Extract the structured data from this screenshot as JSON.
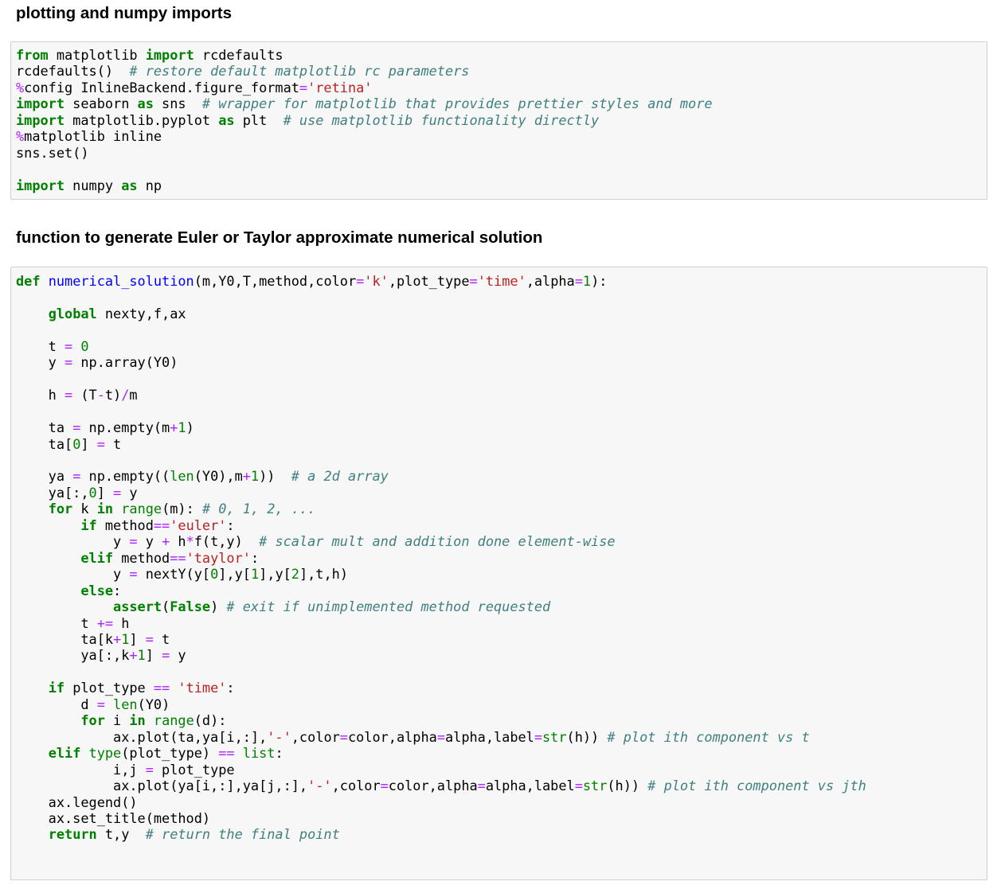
{
  "headings": {
    "imports": "plotting and numpy imports",
    "function": "function to generate Euler or Taylor approximate numerical solution"
  },
  "cells": [
    {
      "name": "imports-cell",
      "lines": [
        [
          [
            "k",
            "from"
          ],
          [
            "t",
            " matplotlib "
          ],
          [
            "k",
            "import"
          ],
          [
            "t",
            " rcdefaults"
          ]
        ],
        [
          [
            "t",
            "rcdefaults()  "
          ],
          [
            "c",
            "# restore default matplotlib rc parameters"
          ]
        ],
        [
          [
            "m",
            "%"
          ],
          [
            "t",
            "config InlineBackend.figure_format"
          ],
          [
            "o",
            "="
          ],
          [
            "s",
            "'retina'"
          ]
        ],
        [
          [
            "k",
            "import"
          ],
          [
            "t",
            " seaborn "
          ],
          [
            "k",
            "as"
          ],
          [
            "t",
            " sns  "
          ],
          [
            "c",
            "# wrapper for matplotlib that provides prettier styles and more"
          ]
        ],
        [
          [
            "k",
            "import"
          ],
          [
            "t",
            " matplotlib.pyplot "
          ],
          [
            "k",
            "as"
          ],
          [
            "t",
            " plt  "
          ],
          [
            "c",
            "# use matplotlib functionality directly"
          ]
        ],
        [
          [
            "m",
            "%"
          ],
          [
            "t",
            "matplotlib inline"
          ]
        ],
        [
          [
            "t",
            "sns.set()"
          ]
        ],
        [],
        [
          [
            "k",
            "import"
          ],
          [
            "t",
            " numpy "
          ],
          [
            "k",
            "as"
          ],
          [
            "t",
            " np"
          ]
        ]
      ]
    },
    {
      "name": "function-cell",
      "lines": [
        [
          [
            "k",
            "def"
          ],
          [
            "t",
            " "
          ],
          [
            "fn",
            "numerical_solution"
          ],
          [
            "t",
            "(m,Y0,T,method,color"
          ],
          [
            "o",
            "="
          ],
          [
            "s",
            "'k'"
          ],
          [
            "t",
            ",plot_type"
          ],
          [
            "o",
            "="
          ],
          [
            "s",
            "'time'"
          ],
          [
            "t",
            ",alpha"
          ],
          [
            "o",
            "="
          ],
          [
            "n",
            "1"
          ],
          [
            "t",
            "):"
          ]
        ],
        [],
        [
          [
            "t",
            "    "
          ],
          [
            "k",
            "global"
          ],
          [
            "t",
            " nexty,f,ax"
          ]
        ],
        [],
        [
          [
            "t",
            "    t "
          ],
          [
            "o",
            "="
          ],
          [
            "t",
            " "
          ],
          [
            "n",
            "0"
          ]
        ],
        [
          [
            "t",
            "    y "
          ],
          [
            "o",
            "="
          ],
          [
            "t",
            " np.array(Y0)"
          ]
        ],
        [],
        [
          [
            "t",
            "    h "
          ],
          [
            "o",
            "="
          ],
          [
            "t",
            " (T"
          ],
          [
            "o",
            "-"
          ],
          [
            "t",
            "t)"
          ],
          [
            "o",
            "/"
          ],
          [
            "t",
            "m"
          ]
        ],
        [],
        [
          [
            "t",
            "    ta "
          ],
          [
            "o",
            "="
          ],
          [
            "t",
            " np.empty(m"
          ],
          [
            "o",
            "+"
          ],
          [
            "n",
            "1"
          ],
          [
            "t",
            ")"
          ]
        ],
        [
          [
            "t",
            "    ta["
          ],
          [
            "n",
            "0"
          ],
          [
            "t",
            "] "
          ],
          [
            "o",
            "="
          ],
          [
            "t",
            " t"
          ]
        ],
        [],
        [
          [
            "t",
            "    ya "
          ],
          [
            "o",
            "="
          ],
          [
            "t",
            " np.empty(("
          ],
          [
            "bi",
            "len"
          ],
          [
            "t",
            "(Y0),m"
          ],
          [
            "o",
            "+"
          ],
          [
            "n",
            "1"
          ],
          [
            "t",
            "))  "
          ],
          [
            "c",
            "# a 2d array"
          ]
        ],
        [
          [
            "t",
            "    ya[:,"
          ],
          [
            "n",
            "0"
          ],
          [
            "t",
            "] "
          ],
          [
            "o",
            "="
          ],
          [
            "t",
            " y"
          ]
        ],
        [
          [
            "t",
            "    "
          ],
          [
            "k",
            "for"
          ],
          [
            "t",
            " k "
          ],
          [
            "k",
            "in"
          ],
          [
            "t",
            " "
          ],
          [
            "bi",
            "range"
          ],
          [
            "t",
            "(m): "
          ],
          [
            "c",
            "# 0, 1, 2, ..."
          ]
        ],
        [
          [
            "t",
            "        "
          ],
          [
            "k",
            "if"
          ],
          [
            "t",
            " method"
          ],
          [
            "o",
            "=="
          ],
          [
            "s",
            "'euler'"
          ],
          [
            "t",
            ":"
          ]
        ],
        [
          [
            "t",
            "            y "
          ],
          [
            "o",
            "="
          ],
          [
            "t",
            " y "
          ],
          [
            "o",
            "+"
          ],
          [
            "t",
            " h"
          ],
          [
            "o",
            "*"
          ],
          [
            "t",
            "f(t,y)  "
          ],
          [
            "c",
            "# scalar mult and addition done element-wise"
          ]
        ],
        [
          [
            "t",
            "        "
          ],
          [
            "k",
            "elif"
          ],
          [
            "t",
            " method"
          ],
          [
            "o",
            "=="
          ],
          [
            "s",
            "'taylor'"
          ],
          [
            "t",
            ":"
          ]
        ],
        [
          [
            "t",
            "            y "
          ],
          [
            "o",
            "="
          ],
          [
            "t",
            " nextY(y["
          ],
          [
            "n",
            "0"
          ],
          [
            "t",
            "],y["
          ],
          [
            "n",
            "1"
          ],
          [
            "t",
            "],y["
          ],
          [
            "n",
            "2"
          ],
          [
            "t",
            "],t,h)"
          ]
        ],
        [
          [
            "t",
            "        "
          ],
          [
            "k",
            "else"
          ],
          [
            "t",
            ":"
          ]
        ],
        [
          [
            "t",
            "            "
          ],
          [
            "k",
            "assert"
          ],
          [
            "t",
            "("
          ],
          [
            "k",
            "False"
          ],
          [
            "t",
            ") "
          ],
          [
            "c",
            "# exit if unimplemented method requested"
          ]
        ],
        [
          [
            "t",
            "        t "
          ],
          [
            "o",
            "+="
          ],
          [
            "t",
            " h"
          ]
        ],
        [
          [
            "t",
            "        ta[k"
          ],
          [
            "o",
            "+"
          ],
          [
            "n",
            "1"
          ],
          [
            "t",
            "] "
          ],
          [
            "o",
            "="
          ],
          [
            "t",
            " t"
          ]
        ],
        [
          [
            "t",
            "        ya[:,k"
          ],
          [
            "o",
            "+"
          ],
          [
            "n",
            "1"
          ],
          [
            "t",
            "] "
          ],
          [
            "o",
            "="
          ],
          [
            "t",
            " y"
          ]
        ],
        [],
        [
          [
            "t",
            "    "
          ],
          [
            "k",
            "if"
          ],
          [
            "t",
            " plot_type "
          ],
          [
            "o",
            "=="
          ],
          [
            "t",
            " "
          ],
          [
            "s",
            "'time'"
          ],
          [
            "t",
            ":"
          ]
        ],
        [
          [
            "t",
            "        d "
          ],
          [
            "o",
            "="
          ],
          [
            "t",
            " "
          ],
          [
            "bi",
            "len"
          ],
          [
            "t",
            "(Y0)"
          ]
        ],
        [
          [
            "t",
            "        "
          ],
          [
            "k",
            "for"
          ],
          [
            "t",
            " i "
          ],
          [
            "k",
            "in"
          ],
          [
            "t",
            " "
          ],
          [
            "bi",
            "range"
          ],
          [
            "t",
            "(d):"
          ]
        ],
        [
          [
            "t",
            "            ax.plot(ta,ya[i,:],"
          ],
          [
            "s",
            "'-'"
          ],
          [
            "t",
            ",color"
          ],
          [
            "o",
            "="
          ],
          [
            "t",
            "color,alpha"
          ],
          [
            "o",
            "="
          ],
          [
            "t",
            "alpha,label"
          ],
          [
            "o",
            "="
          ],
          [
            "bi",
            "str"
          ],
          [
            "t",
            "(h)) "
          ],
          [
            "c",
            "# plot ith component vs t"
          ]
        ],
        [
          [
            "t",
            "    "
          ],
          [
            "k",
            "elif"
          ],
          [
            "t",
            " "
          ],
          [
            "bi",
            "type"
          ],
          [
            "t",
            "(plot_type) "
          ],
          [
            "o",
            "=="
          ],
          [
            "t",
            " "
          ],
          [
            "bi",
            "list"
          ],
          [
            "t",
            ":"
          ]
        ],
        [
          [
            "t",
            "            i,j "
          ],
          [
            "o",
            "="
          ],
          [
            "t",
            " plot_type"
          ]
        ],
        [
          [
            "t",
            "            ax.plot(ya[i,:],ya[j,:],"
          ],
          [
            "s",
            "'-'"
          ],
          [
            "t",
            ",color"
          ],
          [
            "o",
            "="
          ],
          [
            "t",
            "color,alpha"
          ],
          [
            "o",
            "="
          ],
          [
            "t",
            "alpha,label"
          ],
          [
            "o",
            "="
          ],
          [
            "bi",
            "str"
          ],
          [
            "t",
            "(h)) "
          ],
          [
            "c",
            "# plot ith component vs jth"
          ]
        ],
        [
          [
            "t",
            "    ax.legend()"
          ]
        ],
        [
          [
            "t",
            "    ax.set_title(method)"
          ]
        ],
        [
          [
            "t",
            "    "
          ],
          [
            "k",
            "return"
          ],
          [
            "t",
            " t,y  "
          ],
          [
            "c",
            "# return the final point"
          ]
        ]
      ]
    }
  ]
}
